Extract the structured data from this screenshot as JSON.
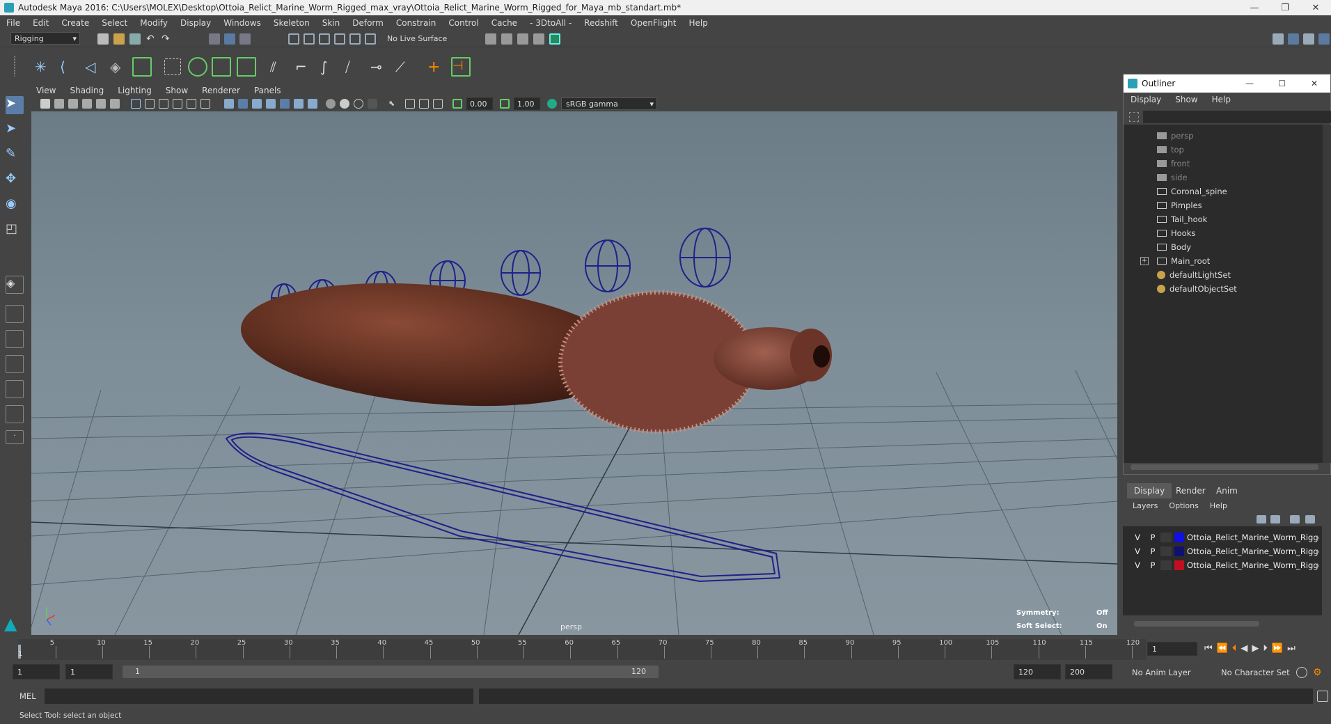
{
  "window": {
    "title": "Autodesk Maya 2016: C:\\Users\\MOLEX\\Desktop\\Ottoia_Relict_Marine_Worm_Rigged_max_vray\\Ottoia_Relict_Marine_Worm_Rigged_for_Maya_mb_standart.mb*",
    "minimize": "—",
    "restore": "❐",
    "close": "✕"
  },
  "menubar": [
    "File",
    "Edit",
    "Create",
    "Select",
    "Modify",
    "Display",
    "Windows",
    "Skeleton",
    "Skin",
    "Deform",
    "Constrain",
    "Control",
    "Cache",
    "- 3DtoAll -",
    "Redshift",
    "OpenFlight",
    "Help"
  ],
  "statusline": {
    "menu_set": "Rigging",
    "live_surface": "No Live Surface"
  },
  "panel": {
    "menus": [
      "View",
      "Shading",
      "Lighting",
      "Show",
      "Renderer",
      "Panels"
    ],
    "near_value": "0.00",
    "far_value": "1.00",
    "color_space": "sRGB gamma"
  },
  "viewport": {
    "camera_label": "persp",
    "symmetry_label": "Symmetry:",
    "symmetry_value": "Off",
    "soft_select_label": "Soft Select:",
    "soft_select_value": "On"
  },
  "outliner": {
    "title": "Outliner",
    "menus": [
      "Display",
      "Show",
      "Help"
    ],
    "items": [
      {
        "name": "persp",
        "type": "camera"
      },
      {
        "name": "top",
        "type": "camera"
      },
      {
        "name": "front",
        "type": "camera"
      },
      {
        "name": "side",
        "type": "camera"
      },
      {
        "name": "Coronal_spine",
        "type": "group"
      },
      {
        "name": "Pimples",
        "type": "group"
      },
      {
        "name": "Tail_hook",
        "type": "group"
      },
      {
        "name": "Hooks",
        "type": "group"
      },
      {
        "name": "Body",
        "type": "group"
      },
      {
        "name": "Main_root",
        "type": "group",
        "expandable": true
      },
      {
        "name": "defaultLightSet",
        "type": "set"
      },
      {
        "name": "defaultObjectSet",
        "type": "set"
      }
    ]
  },
  "layers": {
    "tabs": [
      "Display",
      "Render",
      "Anim"
    ],
    "active_tab": "Display",
    "menus": [
      "Layers",
      "Options",
      "Help"
    ],
    "rows": [
      {
        "v": "V",
        "p": "P",
        "color": "#1010e0",
        "name": "Ottoia_Relict_Marine_Worm_Rigged"
      },
      {
        "v": "V",
        "p": "P",
        "color": "#101070",
        "name": "Ottoia_Relict_Marine_Worm_Rigged"
      },
      {
        "v": "V",
        "p": "P",
        "color": "#c01020",
        "name": "Ottoia_Relict_Marine_Worm_Rigged"
      }
    ]
  },
  "timeline": {
    "ticks": [
      "5",
      "10",
      "15",
      "20",
      "25",
      "30",
      "35",
      "40",
      "45",
      "50",
      "55",
      "60",
      "65",
      "70",
      "75",
      "80",
      "85",
      "90",
      "95",
      "100",
      "105",
      "110",
      "115",
      "120"
    ],
    "start_tick": "1",
    "current_frame": "1"
  },
  "range": {
    "start": "1",
    "anim_start": "1",
    "slider_start": "1",
    "slider_end": "120",
    "end": "120",
    "anim_end": "200",
    "anim_layer": "No Anim Layer",
    "character_set": "No Character Set"
  },
  "command": {
    "mode": "MEL"
  },
  "help": {
    "text": "Select Tool: select an object"
  }
}
